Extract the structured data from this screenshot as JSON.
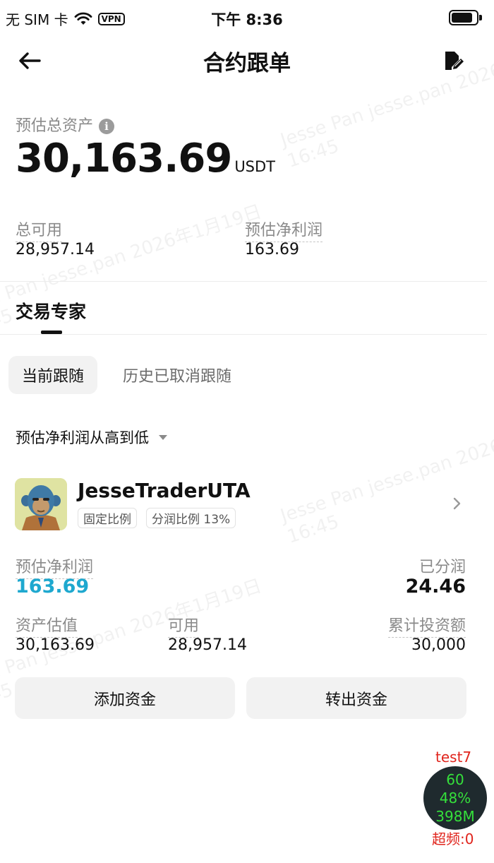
{
  "status_bar": {
    "carrier": "无 SIM 卡",
    "vpn": "VPN",
    "time": "下午 8:36"
  },
  "nav": {
    "title": "合约跟单"
  },
  "assets": {
    "total_label": "预估总资产",
    "total_value": "30,163.69",
    "total_unit": "USDT",
    "available_label": "总可用",
    "available_value": "28,957.14",
    "profit_label": "预估净利润",
    "profit_value": "163.69"
  },
  "tabs": {
    "active": "交易专家"
  },
  "sub_tabs": {
    "current": "当前跟随",
    "history": "历史已取消跟随"
  },
  "sort": {
    "label": "预估净利润从高到低"
  },
  "trader": {
    "name": "JesseTraderUTA",
    "tag_fixed": "固定比例",
    "tag_share": "分润比例 13%",
    "profit_label": "预估净利润",
    "profit_value": "163.69",
    "shared_label": "已分润",
    "shared_value": "24.46",
    "asset_label": "资产估值",
    "asset_value": "30,163.69",
    "available_label": "可用",
    "available_value": "28,957.14",
    "invest_label": "累计投资额",
    "invest_value": "30,000"
  },
  "actions": {
    "add": "添加资金",
    "withdraw": "转出资金"
  },
  "watermark": {
    "line1": "Jesse Pan jesse.pan 2026年1月19日",
    "line2": "16:45"
  },
  "debug": {
    "label": "test7",
    "fps": "60",
    "cpu": "48%",
    "mem": "398M",
    "freq": "超频:0"
  },
  "colors": {
    "accent": "#1ea8cf",
    "debug_red": "#e0241c",
    "debug_green": "#35e03b"
  }
}
